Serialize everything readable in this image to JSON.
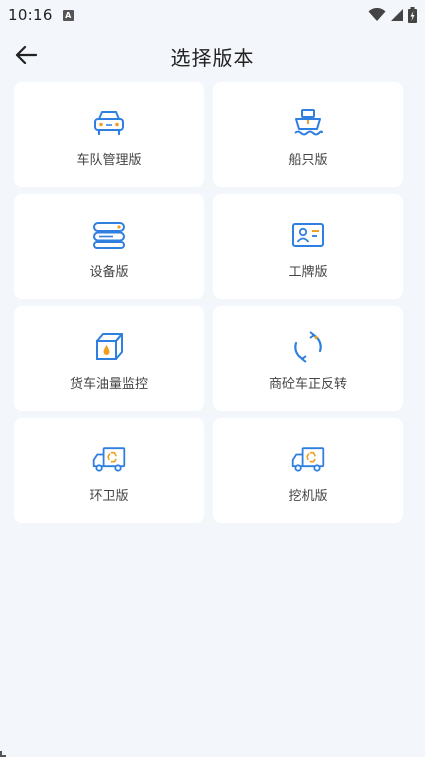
{
  "status_bar": {
    "time": "10:16",
    "notification_letter": "A",
    "icons": [
      "wifi-icon",
      "signal-icon",
      "battery-icon"
    ]
  },
  "header": {
    "title": "选择版本",
    "back_icon": "arrow-left-icon"
  },
  "colors": {
    "accent_blue": "#2f7fe0",
    "accent_orange": "#f0a020",
    "background": "#f3f6fa",
    "card": "#ffffff"
  },
  "versions": [
    {
      "label": "车队管理版",
      "icon": "car-icon"
    },
    {
      "label": "船只版",
      "icon": "ship-icon"
    },
    {
      "label": "设备版",
      "icon": "server-icon"
    },
    {
      "label": "工牌版",
      "icon": "id-card-icon"
    },
    {
      "label": "货车油量监控",
      "icon": "fuel-box-icon"
    },
    {
      "label": "商砼车正反转",
      "icon": "rotate-icon"
    },
    {
      "label": "环卫版",
      "icon": "sanitation-truck-icon"
    },
    {
      "label": "挖机版",
      "icon": "excavator-truck-icon"
    }
  ]
}
